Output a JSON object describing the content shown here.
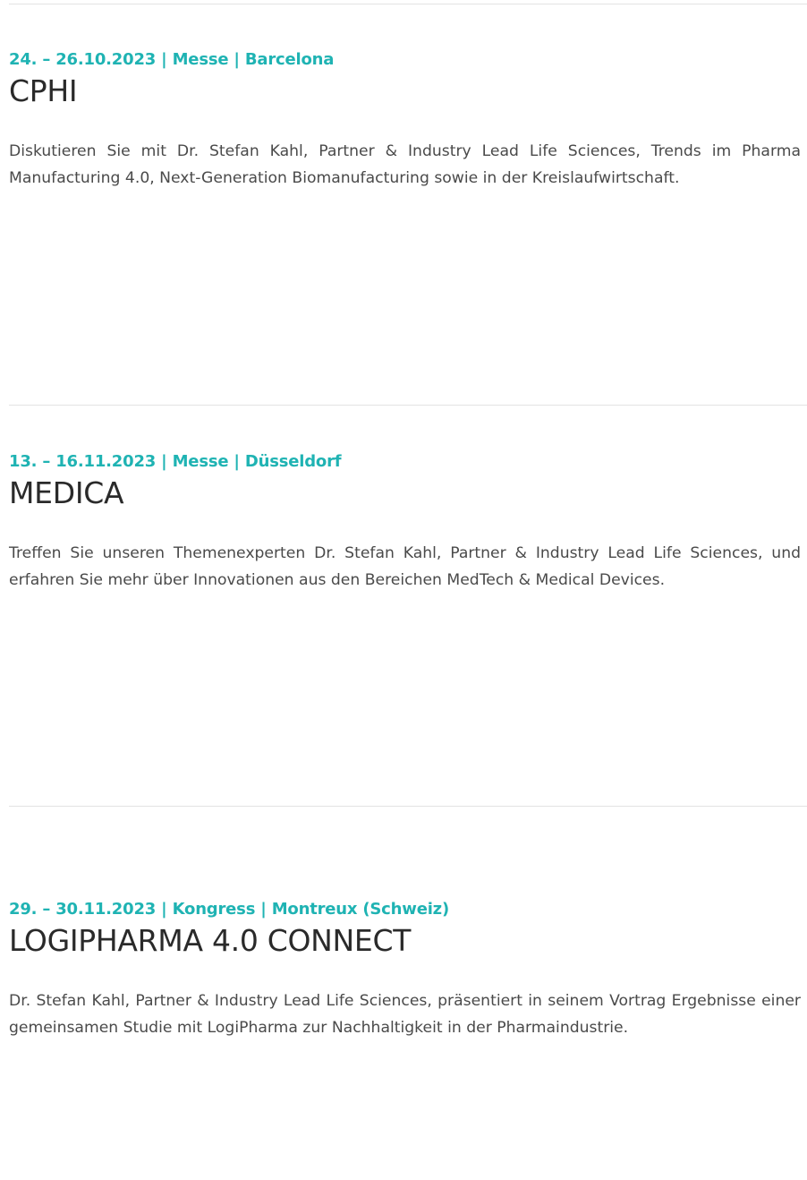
{
  "events": [
    {
      "meta": "24. – 26.10.2023 | Messe | Barcelona",
      "title": "CPHI",
      "description": "Diskutieren Sie mit Dr. Stefan Kahl, Partner & Industry Lead Life Sciences, Trends im Pharma Manufacturing 4.0, Next-Generation Biomanufacturing sowie in der Kreislaufwirtschaft."
    },
    {
      "meta": "13. – 16.11.2023 | Messe | Düsseldorf",
      "title": "MEDICA",
      "description": "Treffen Sie unseren Themenexperten Dr. Stefan Kahl, Partner & Industry Lead Life Sciences, und erfahren Sie mehr über Innovationen aus den Bereichen MedTech & Medical Devices."
    },
    {
      "meta": "29. – 30.11.2023 | Kongress | Montreux (Schweiz)",
      "title": "LOGIPHARMA 4.0 CONNECT",
      "description": "Dr. Stefan Kahl, Partner & Industry Lead Life Sciences, präsentiert in seinem Vortrag Ergebnisse einer gemeinsamen Studie mit LogiPharma zur Nachhaltigkeit in der Pharmaindustrie."
    }
  ],
  "colors": {
    "accent": "#1fb3b3",
    "divider": "#e3e3e3",
    "text": "#4a4a4a"
  }
}
